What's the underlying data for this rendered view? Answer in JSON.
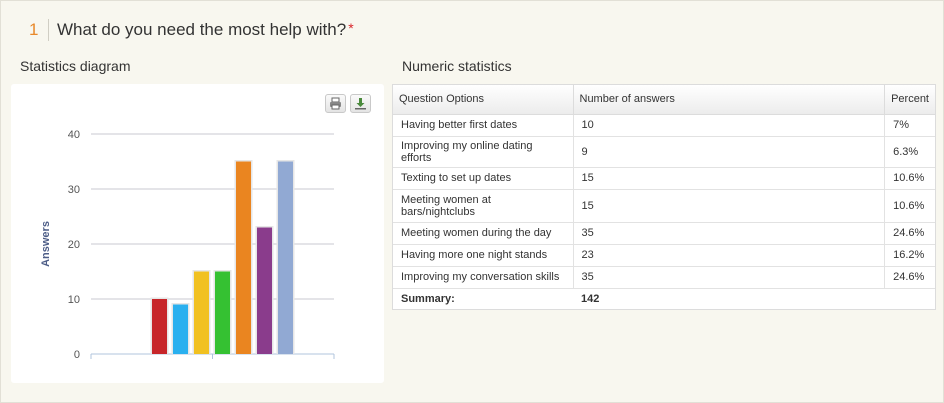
{
  "question": {
    "number": "1",
    "title": "What do you need the most help with?",
    "required_mark": "*"
  },
  "sections": {
    "diagram_title": "Statistics diagram",
    "numeric_title": "Numeric statistics"
  },
  "toolbar": {
    "print_icon": "printer-icon",
    "download_icon": "download-icon"
  },
  "table": {
    "headers": [
      "Question Options",
      "Number of answers",
      "Percent"
    ],
    "rows": [
      {
        "option": "Having better first dates",
        "answers": "10",
        "percent": "7%"
      },
      {
        "option": "Improving my online dating efforts",
        "answers": "9",
        "percent": "6.3%"
      },
      {
        "option": "Texting to set up dates",
        "answers": "15",
        "percent": "10.6%"
      },
      {
        "option": "Meeting women at bars/nightclubs",
        "answers": "15",
        "percent": "10.6%"
      },
      {
        "option": "Meeting women during the day",
        "answers": "35",
        "percent": "24.6%"
      },
      {
        "option": "Having more one night stands",
        "answers": "23",
        "percent": "16.2%"
      },
      {
        "option": "Improving my conversation skills",
        "answers": "35",
        "percent": "24.6%"
      }
    ],
    "summary_label": "Summary:",
    "summary_value": "142"
  },
  "colors": {
    "accent_number": "#e8892b",
    "required": "#d9262b",
    "gridline": "#c8c8d0",
    "axis": "#b0c4de"
  },
  "chart_data": {
    "type": "bar",
    "title": "",
    "xlabel": "",
    "ylabel": "Answers",
    "categories": [
      "Having better first dates",
      "Improving my online dating efforts",
      "Texting to set up dates",
      "Meeting women at bars/nightclubs",
      "Meeting women during the day",
      "Having more one night stands",
      "Improving my conversation skills"
    ],
    "values": [
      10,
      9,
      15,
      15,
      35,
      23,
      35
    ],
    "colors": [
      "#c7262a",
      "#2ab0ef",
      "#f1c121",
      "#35c132",
      "#ea8520",
      "#8a3c8c",
      "#91a9d3"
    ],
    "ylim": [
      0,
      40
    ],
    "yticks": [
      0,
      10,
      20,
      30,
      40
    ],
    "grid": true,
    "legend": "none"
  }
}
